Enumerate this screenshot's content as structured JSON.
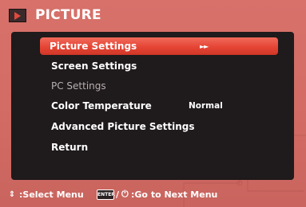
{
  "header": {
    "title": "PICTURE",
    "icon": "picture-mode-icon"
  },
  "menu": {
    "items": [
      {
        "label": "Picture Settings",
        "value": "",
        "arrows": "►►",
        "selected": true,
        "enabled": true
      },
      {
        "label": "Screen Settings",
        "value": "",
        "selected": false,
        "enabled": true
      },
      {
        "label": "PC Settings",
        "value": "",
        "selected": false,
        "enabled": false
      },
      {
        "label": "Color Temperature",
        "value": "Normal",
        "selected": false,
        "enabled": true
      },
      {
        "label": "Advanced Picture Settings",
        "value": "",
        "selected": false,
        "enabled": true
      },
      {
        "label": "Return",
        "value": "",
        "selected": false,
        "enabled": true
      }
    ]
  },
  "footer": {
    "select_text": ":Select Menu",
    "enter_key": "ENTER",
    "slash": "/",
    "power_glyph": "⏻",
    "next_text": ":Go to Next Menu"
  },
  "colors": {
    "frame": "#d36c64",
    "panel": "#1f1a1b",
    "highlight": "#e54535",
    "text": "#ffffff",
    "disabled_text": "#b8b0b1"
  }
}
